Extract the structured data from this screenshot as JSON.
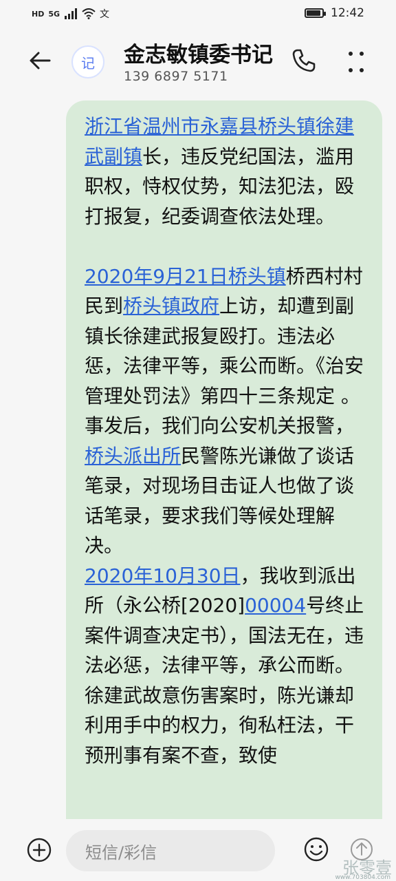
{
  "status_bar": {
    "left_hd": "HD",
    "left_network": "5G",
    "left_extra": "文",
    "time": "12:42"
  },
  "header": {
    "avatar_text": "记",
    "contact_name": "金志敏镇委书记",
    "contact_phone": "139 6897 5171"
  },
  "message": {
    "p1_link": "浙江省温州市永嘉县桥头镇徐建武副镇",
    "p1_text": "长，违反党纪国法，滥用职权，恃权仗势，知法犯法，殴打报复，纪委调查依法处理。",
    "p2_link1": "2020年9月21日桥头镇",
    "p2_text1": "桥西村村民到",
    "p2_link2": "桥头镇政府",
    "p2_text2": "上访，却遭到副镇长徐建武报复殴打。违法必惩，法律平等，乘公而断。《治安管理处罚法》第四十三条规定 。 事发后，我们向公安机关报警，",
    "p2_link3": "桥头派出所",
    "p2_text3": "民警陈光谦做了谈话笔录，对现场目击证人也做了谈话笔录，要求我们等候处理解决。",
    "p3_link1": "2020年10月30日",
    "p3_text1": "，我收到派出所（永公桥[2020]",
    "p3_link2": "00004",
    "p3_text2": "号终止案件调查决定书），国法无在，违法必惩，法律平等，承公而断。",
    "p4_text": "徐建武故意伤害案时，陈光谦却利用手中的权力，徇私枉法，干预刑事有案不查，致使"
  },
  "composer": {
    "placeholder": "短信/彩信"
  },
  "watermark": {
    "brand": "张零壹",
    "url": "www.703804.com"
  },
  "icons": {
    "back": "back-arrow-icon",
    "call": "phone-icon",
    "more": "more-vertical-icon",
    "add": "plus-circle-icon",
    "emoji": "emoji-icon",
    "send": "send-icon"
  },
  "colors": {
    "bubble": "#d9ebd9",
    "link": "#2a62d6",
    "avatar_accent": "#5a7cf0"
  }
}
